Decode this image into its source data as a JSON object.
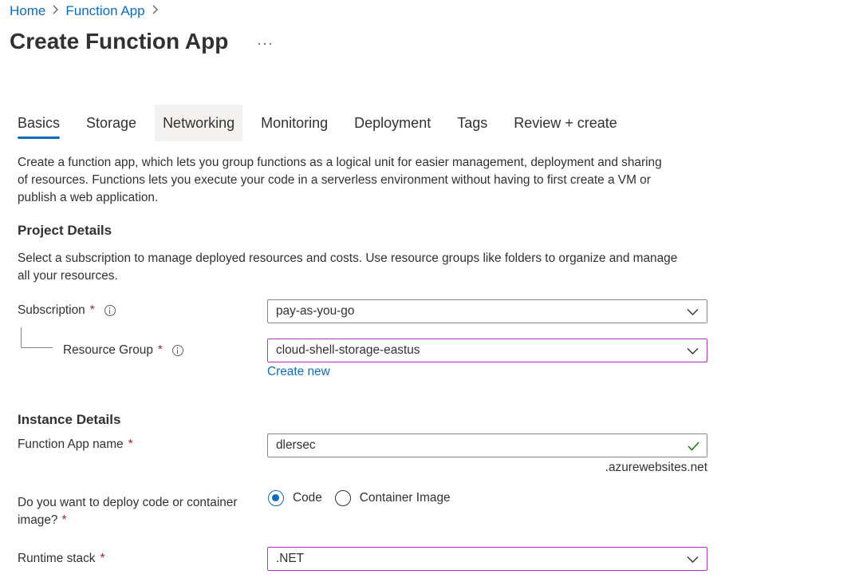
{
  "breadcrumb": {
    "home": "Home",
    "function_app": "Function App",
    "sep": ">"
  },
  "page": {
    "title": "Create Function App",
    "more": "···"
  },
  "tabs": [
    {
      "label": "Basics"
    },
    {
      "label": "Storage"
    },
    {
      "label": "Networking"
    },
    {
      "label": "Monitoring"
    },
    {
      "label": "Deployment"
    },
    {
      "label": "Tags"
    },
    {
      "label": "Review + create"
    }
  ],
  "intro": {
    "line1": "Create a function app, which lets you group functions as a logical unit for easier management, deployment and sharing",
    "line2": "of resources. Functions lets you execute your code in a serverless environment without having to first create a VM or",
    "line3": "publish a web application."
  },
  "project": {
    "heading": "Project Details",
    "desc1": "Select a subscription to manage deployed resources and costs. Use resource groups like folders to organize and manage",
    "desc2": "all your resources.",
    "subscription_label": "Subscription",
    "subscription_value": "pay-as-you-go",
    "rg_label": "Resource Group",
    "rg_value": "cloud-shell-storage-eastus",
    "create_new": "Create new"
  },
  "instance": {
    "heading": "Instance Details",
    "name_label": "Function App name",
    "name_value": "dlersec",
    "name_suffix": ".azurewebsites.net",
    "deploy_label_1": "Do you want to deploy code or container",
    "deploy_label_2": "image?",
    "deploy_options": [
      "Code",
      "Container Image"
    ],
    "deploy_selected": "Code",
    "runtime_label": "Runtime stack",
    "runtime_value": ".NET"
  },
  "required_mark": "*",
  "colors": {
    "accent": "#0f6cbd",
    "required": "#a4262c",
    "focus_border": "#a83ab8",
    "valid_check": "#107c10"
  }
}
